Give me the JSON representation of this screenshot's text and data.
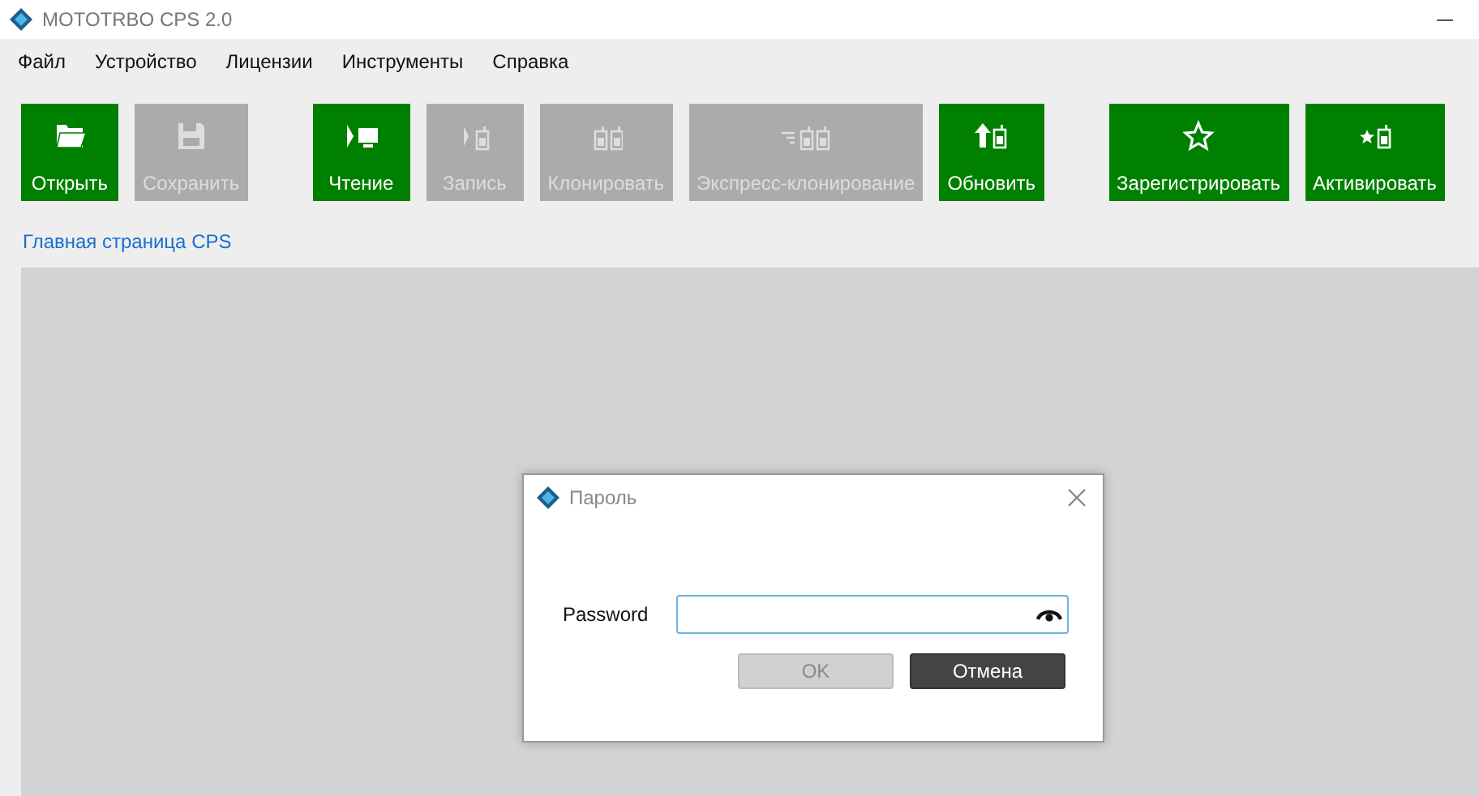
{
  "window": {
    "title": "MOTOTRBO CPS 2.0"
  },
  "menu": [
    {
      "label": "Файл"
    },
    {
      "label": "Устройство"
    },
    {
      "label": "Лицензии"
    },
    {
      "label": "Инструменты"
    },
    {
      "label": "Справка"
    }
  ],
  "toolbar": [
    [
      {
        "label": "Открыть",
        "kind": "folder",
        "disabled": false
      },
      {
        "label": "Сохранить",
        "kind": "floppy",
        "disabled": true
      }
    ],
    [
      {
        "label": "Чтение",
        "kind": "read",
        "disabled": false
      },
      {
        "label": "Запись",
        "kind": "write",
        "disabled": true
      },
      {
        "label": "Клонировать",
        "kind": "clone",
        "disabled": true
      },
      {
        "label": "Экспресс-клонирование",
        "kind": "express",
        "disabled": true
      },
      {
        "label": "Обновить",
        "kind": "update",
        "disabled": false
      }
    ],
    [
      {
        "label": "Зарегистрировать",
        "kind": "star",
        "disabled": false
      },
      {
        "label": "Активировать",
        "kind": "starradio",
        "disabled": false
      }
    ]
  ],
  "breadcrumb": "Главная страница CPS",
  "dialog": {
    "title": "Пароль",
    "field_label": "Password",
    "buttons": [
      {
        "label": "OK",
        "kind": "ok",
        "disabled": true
      },
      {
        "label": "Отмена",
        "kind": "cancel",
        "disabled": false
      }
    ]
  }
}
